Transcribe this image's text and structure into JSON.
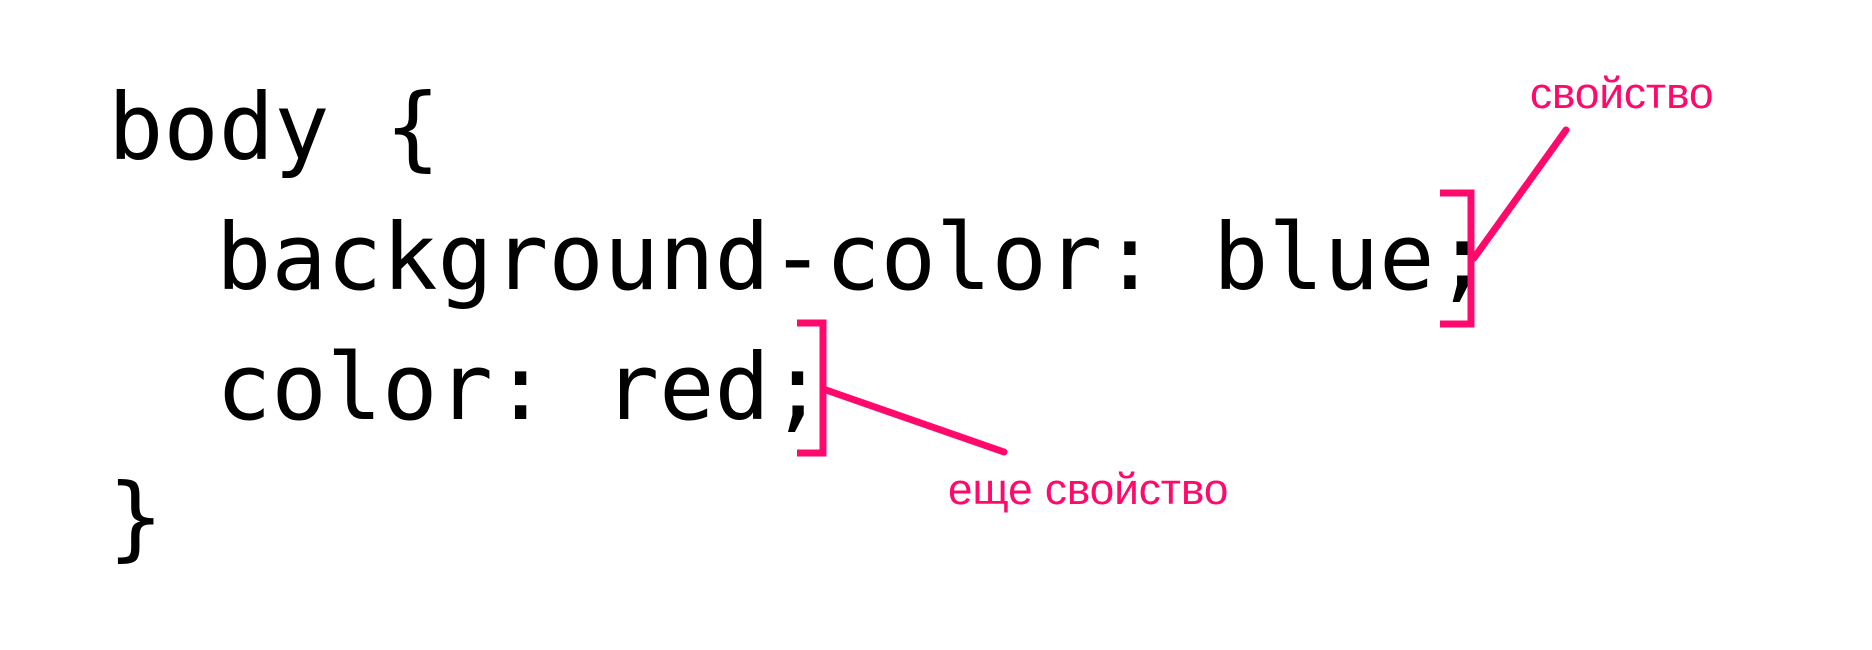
{
  "code": {
    "lines": [
      "body {",
      "background-color: blue;",
      "color: red;",
      "}"
    ]
  },
  "annotations": {
    "property": "свойство",
    "another_property": "еще свойство"
  },
  "colors": {
    "text": "#000000",
    "accent": "#ff0a6c",
    "background": "#ffffff"
  }
}
